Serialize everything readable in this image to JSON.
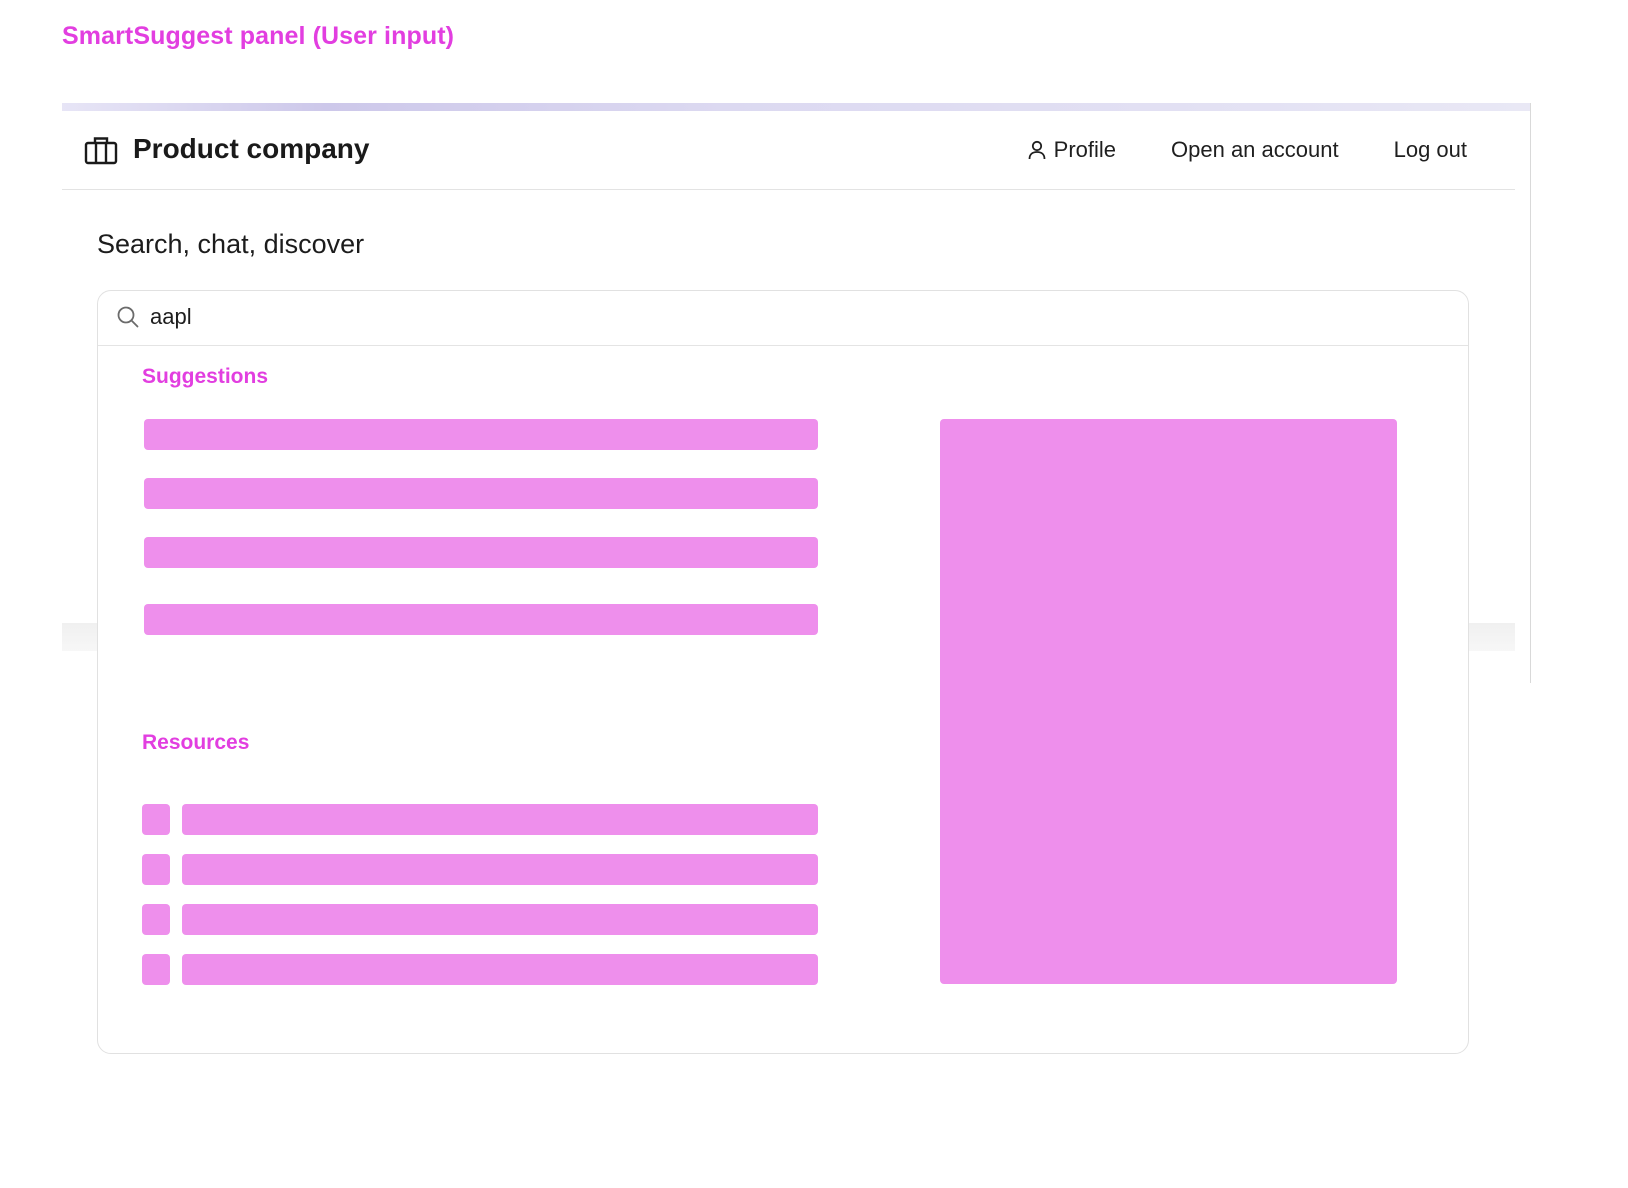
{
  "annotation": {
    "title": "SmartSuggest panel (User input)"
  },
  "navbar": {
    "brand_name": "Product company",
    "brand_icon": "briefcase-icon",
    "links": {
      "profile": "Profile",
      "profile_icon": "person-icon",
      "open_account": "Open an account",
      "logout": "Log out"
    }
  },
  "page": {
    "heading": "Search, chat, discover"
  },
  "search": {
    "icon": "search-icon",
    "value": "aapl",
    "placeholder": ""
  },
  "suggest_panel": {
    "suggestions_title": "Suggestions",
    "resources_title": "Resources"
  },
  "colors": {
    "accent": "#e23ee0",
    "placeholder_fill": "#ee8fec",
    "text": "#1c1c1c",
    "border": "#e1e1e1"
  }
}
